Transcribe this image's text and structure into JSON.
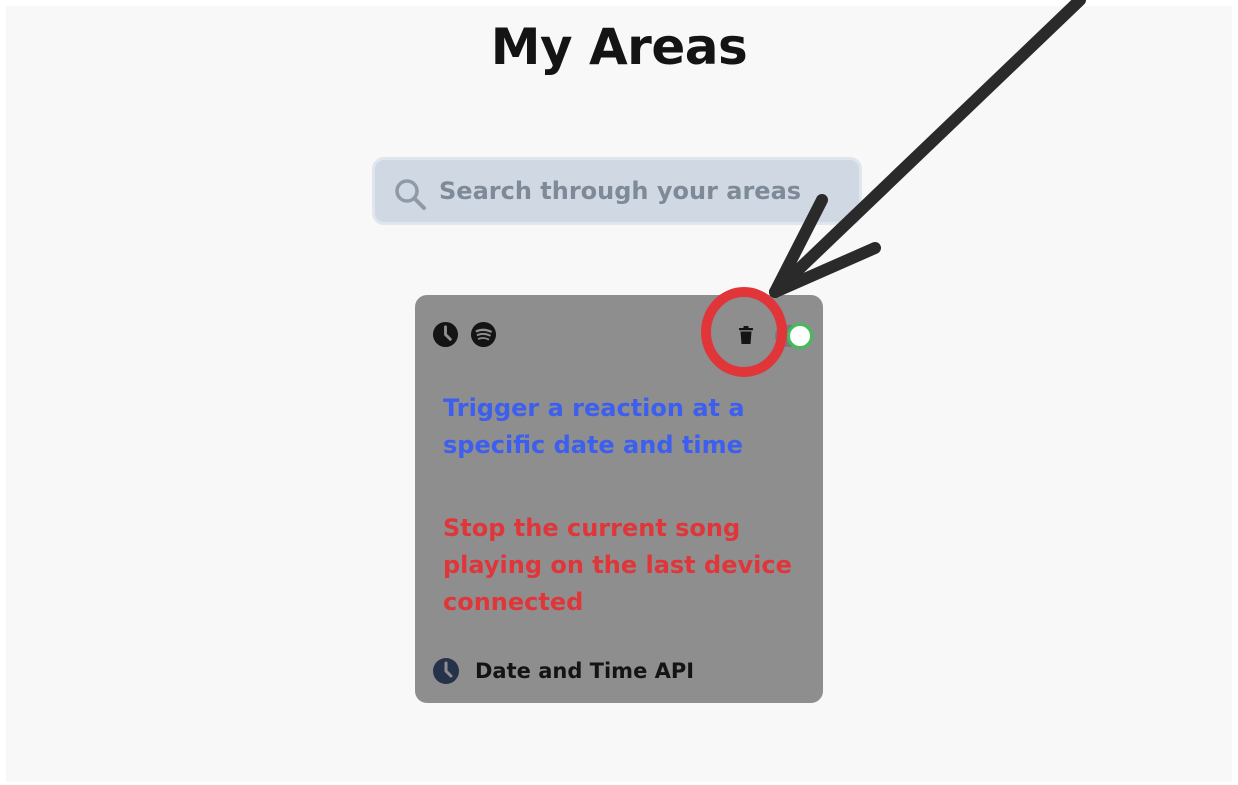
{
  "page": {
    "title": "My Areas"
  },
  "search": {
    "placeholder": "Search through your areas",
    "value": ""
  },
  "area_card": {
    "trigger_text": "Trigger a reaction at a specific date and time",
    "reaction_text": "Stop the current song playing on the last device connected",
    "service_label": "Date and Time API",
    "service_icons": [
      "clock-icon",
      "spotify-icon"
    ],
    "enabled": true,
    "colors": {
      "card_bg": "#8e8e8e",
      "trigger": "#3c5ff0",
      "reaction": "#e0363a",
      "toggle_on": "#3fbe5a"
    }
  },
  "annotation": {
    "highlight_color": "#e0363a",
    "arrow_color": "#2a2a2a",
    "target": "delete-button"
  }
}
